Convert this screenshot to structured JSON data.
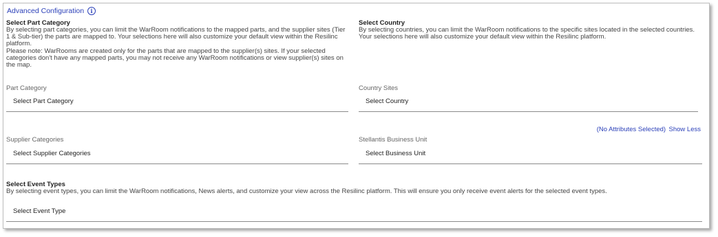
{
  "advanced": {
    "title": "Advanced Configuration",
    "info_icon": "info-icon"
  },
  "part_section": {
    "heading": "Select Part Category",
    "description": "By selecting part categories, you can limit the WarRoom notifications to the mapped parts, and the supplier sites (Tier 1 & Sub-tier) the parts are mapped to. Your selections here will also customize your default view within the Resilinc platform.",
    "note": "Please note: WarRooms are created only for the parts that are mapped to the supplier(s) sites. If your selected categories don't have any mapped parts, you may not receive any WarRoom notifications or view supplier(s) sites on the map."
  },
  "country_section": {
    "heading": "Select Country",
    "description": "By selecting countries, you can limit the WarRoom notifications to the specific sites located in the selected countries. Your selections here will also customize your default view within the Resilinc platform."
  },
  "fields": {
    "part_category": {
      "label": "Part Category",
      "value": "Select Part Category"
    },
    "country_sites": {
      "label": "Country Sites",
      "value": "Select Country"
    },
    "supplier_categories": {
      "label": "Supplier Categories",
      "value": "Select Supplier Categories"
    },
    "business_unit": {
      "label": "Stellantis Business Unit",
      "value": "Select Business Unit"
    },
    "event_type": {
      "value": "Select Event Type"
    }
  },
  "attributes_toggle": {
    "status": "(No Attributes Selected)",
    "action": "Show Less"
  },
  "event_section": {
    "heading": "Select Event Types",
    "description": "By selecting event types, you can limit the WarRoom notifications, News alerts, and customize your view across the Resilinc platform. This will ensure you only receive event alerts for the selected event types."
  },
  "colors": {
    "accent": "#2a3fb8",
    "border": "#8a8a8a"
  }
}
